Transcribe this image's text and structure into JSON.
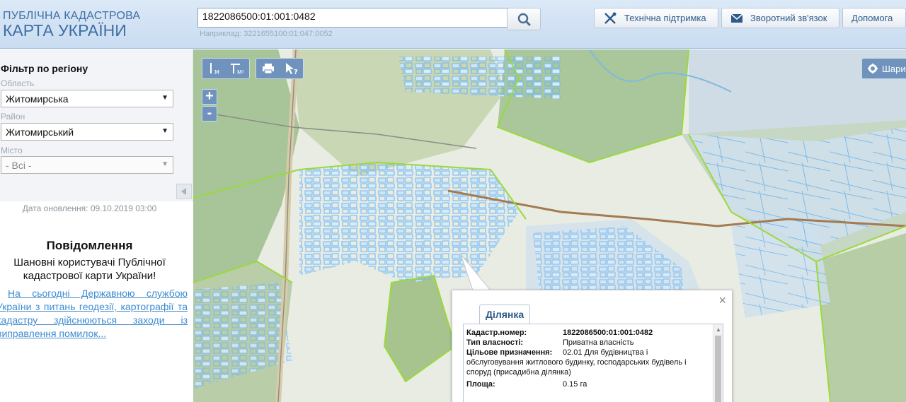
{
  "header": {
    "logo_line1": "ПУБЛІЧНА КАДАСТРОВА",
    "logo_line2": "КАРТА УКРАЇНИ",
    "search_value": "1822086500:01:001:0482",
    "search_hint": "Наприклад: 3221655100:01:047:0052",
    "support_label": "Технічна підтримка",
    "feedback_label": "Зворотний зв'язок",
    "help_label": "Допомога"
  },
  "sidebar": {
    "filter_title": "Фільтр по регіону",
    "region_label": "Область",
    "region_value": "Житомирська",
    "district_label": "Район",
    "district_value": "Житомирський",
    "city_label": "Місто",
    "city_value": "- Всі -",
    "update_date": "Дата оновлення: 09.10.2019 03:00",
    "notice_title": "Повідомлення",
    "notice_greeting": "Шановні користувачі Публічної кадастрової карти України!",
    "notice_link": "На сьогодні Державною службою України з питань геодезії, картографії та кадастру здійснюються заходи із виправлення помилок..."
  },
  "map": {
    "tool_measure_line": "М",
    "tool_measure_area": "М²",
    "tool_info": "?",
    "zoom_in": "+",
    "zoom_out": "-",
    "layers_label": "Шари"
  },
  "popup": {
    "tab_label": "Ділянка",
    "close": "×",
    "cadastral_label": "Кадастр.номер:",
    "cadastral_value": "1822086500:01:001:0482",
    "ownership_label": "Тип власності:",
    "ownership_value": "Приватна власність",
    "purpose_label": "Цільове призначення:",
    "purpose_value": "02.01 Для будівництва і",
    "purpose_cont": "обслуговування житлового будинку, господарських будівель і споруд (присадибна ділянка)",
    "area_label": "Площа:",
    "area_value": "0.15 га"
  },
  "colors": {
    "header_bg": "#d3e3f4",
    "map_button": "#6f93bd",
    "parcel_outline": "#6fb6f2",
    "boundary_green": "#9ad93c",
    "link": "#3e8bd0"
  }
}
